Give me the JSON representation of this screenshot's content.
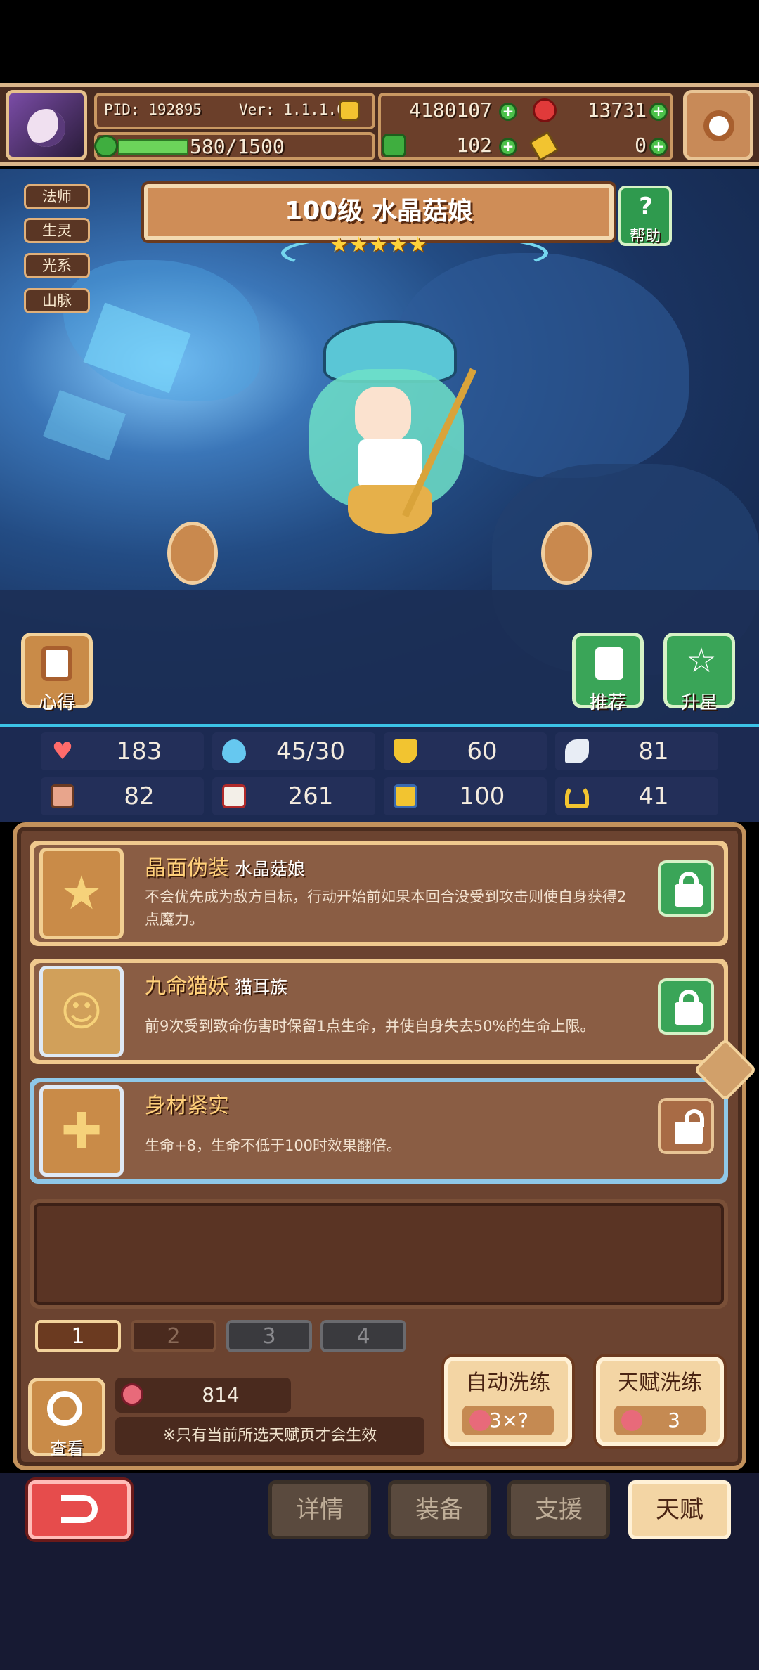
{
  "header": {
    "pid": "PID: 192895",
    "version": "Ver: 1.1.1.0",
    "exp": "580/1500",
    "exp_fraction": 0.387,
    "gold": "4180107",
    "gems": "13731",
    "clover": "102",
    "key": "0"
  },
  "hero": {
    "title": "100级 水晶菇娘",
    "stars": 5,
    "tags": [
      "法师",
      "生灵",
      "光系",
      "山脉"
    ],
    "help_label": "帮助",
    "left_button": "心得",
    "recommend_button": "推荐",
    "upgrade_button": "升星"
  },
  "stats": [
    {
      "icon": "heart-icon",
      "value": "183"
    },
    {
      "icon": "mana-drop-icon",
      "value": "45/30"
    },
    {
      "icon": "shield-icon",
      "value": "60"
    },
    {
      "icon": "wing-icon",
      "value": "81"
    },
    {
      "icon": "fist-icon",
      "value": "82"
    },
    {
      "icon": "spellbook-icon",
      "value": "261"
    },
    {
      "icon": "scroll-icon",
      "value": "100"
    },
    {
      "icon": "horseshoe-icon",
      "value": "41"
    }
  ],
  "talents": [
    {
      "name": "晶面伪装",
      "source": "水晶菇娘",
      "desc": "不会优先成为敌方目标，行动开始前如果本回合没受到攻击则使自身获得2点魔力。",
      "locked": true
    },
    {
      "name": "九命猫妖",
      "source": "猫耳族",
      "desc": "前9次受到致命伤害时保留1点生命，并使自身失去50%的生命上限。",
      "locked": true
    },
    {
      "name": "身材紧实",
      "source": "",
      "desc": "生命+8，生命不低于100时效果翻倍。",
      "locked": false
    }
  ],
  "pages": [
    "1",
    "2",
    "3",
    "4"
  ],
  "fruit_count": "814",
  "note": "※只有当前所选天赋页才会生效",
  "view_label": "查看",
  "auto_wash": {
    "label": "自动洗练",
    "cost": "3×?"
  },
  "talent_wash": {
    "label": "天赋洗练",
    "cost": "3"
  },
  "nav": [
    "详情",
    "装备",
    "支援",
    "天赋"
  ],
  "colors": {
    "accent_green": "#4cc14a",
    "panel_brown": "#6b4330",
    "active_gold": "#f3d5a4",
    "back_red": "#e64c4c"
  }
}
